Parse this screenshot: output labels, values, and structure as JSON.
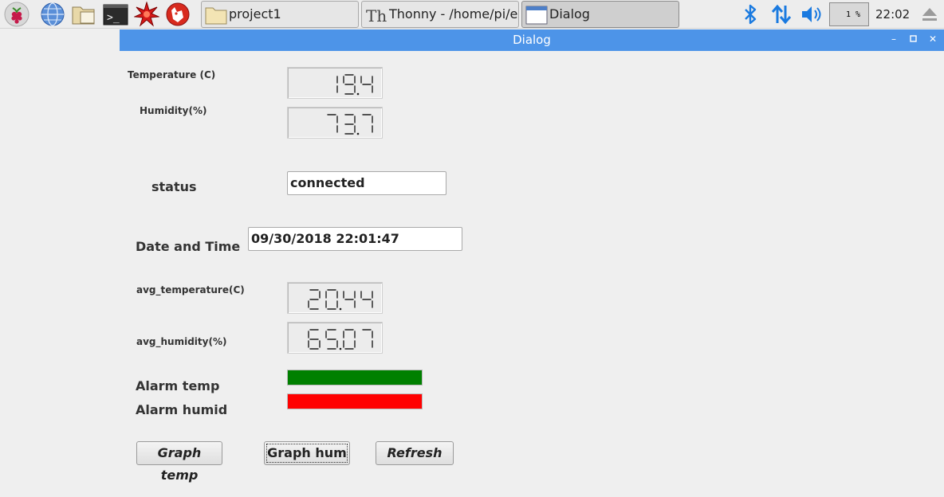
{
  "taskbar": {
    "tasks": [
      {
        "label": "project1"
      },
      {
        "label": "Thonny  -  /home/pi/e..."
      },
      {
        "label": "Dialog"
      }
    ],
    "cpu_label": "1 %",
    "clock": "22:02"
  },
  "dialog": {
    "title": "Dialog",
    "temperature_label": "Temperature (C)",
    "temperature_value": "19.4",
    "humidity_label": "Humidity(%)",
    "humidity_value": "73.7",
    "status_label": "status",
    "status_value": "connected",
    "datetime_label": "Date and Time",
    "datetime_value": "09/30/2018 22:01:47",
    "avg_temp_label": "avg_temperature(C)",
    "avg_temp_value": "20.44",
    "avg_hum_label": "avg_humidity(%)",
    "avg_hum_value": "65.07",
    "alarm_temp_label": "Alarm temp",
    "alarm_temp_color": "#008000",
    "alarm_humid_label": "Alarm humid",
    "alarm_humid_color": "#ff0000",
    "buttons": {
      "graph_temp": "Graph temp",
      "graph_hum": "Graph hum",
      "refresh": "Refresh"
    }
  },
  "icons": [
    "raspberry-icon",
    "web-browser-icon",
    "file-manager-icon",
    "terminal-icon",
    "mathematica-icon",
    "wolfram-icon",
    "folder-icon",
    "thonny-icon",
    "window-icon",
    "bluetooth-icon",
    "network-arrows-icon",
    "volume-icon",
    "eject-icon"
  ]
}
